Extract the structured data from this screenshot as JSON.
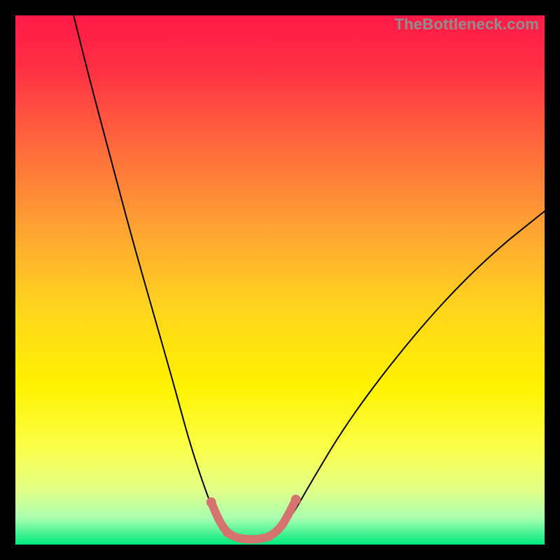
{
  "watermark": "TheBottleneck.com",
  "chart_data": {
    "type": "line",
    "title": "",
    "xlabel": "",
    "ylabel": "",
    "xlim": [
      0,
      100
    ],
    "ylim": [
      0,
      100
    ],
    "background_gradient": {
      "stops": [
        {
          "pos": 0.0,
          "color": "#ff1a47"
        },
        {
          "pos": 0.1,
          "color": "#ff2f44"
        },
        {
          "pos": 0.25,
          "color": "#ff6b3d"
        },
        {
          "pos": 0.4,
          "color": "#ffa233"
        },
        {
          "pos": 0.55,
          "color": "#ffd41e"
        },
        {
          "pos": 0.7,
          "color": "#fff200"
        },
        {
          "pos": 0.82,
          "color": "#faff4a"
        },
        {
          "pos": 0.9,
          "color": "#e0ff8a"
        },
        {
          "pos": 0.95,
          "color": "#a8ffb0"
        },
        {
          "pos": 1.0,
          "color": "#00e97e"
        }
      ]
    },
    "series": [
      {
        "name": "bottleneck-curve",
        "stroke": "#000000",
        "points": [
          {
            "x": 11,
            "y": 100
          },
          {
            "x": 14,
            "y": 88
          },
          {
            "x": 18,
            "y": 73
          },
          {
            "x": 22,
            "y": 58
          },
          {
            "x": 26,
            "y": 44
          },
          {
            "x": 30,
            "y": 30
          },
          {
            "x": 33,
            "y": 19
          },
          {
            "x": 36,
            "y": 10
          },
          {
            "x": 38,
            "y": 5
          },
          {
            "x": 40,
            "y": 1.5
          },
          {
            "x": 43,
            "y": 0.5
          },
          {
            "x": 46,
            "y": 0.5
          },
          {
            "x": 49,
            "y": 1.5
          },
          {
            "x": 52,
            "y": 5
          },
          {
            "x": 56,
            "y": 12
          },
          {
            "x": 62,
            "y": 22
          },
          {
            "x": 70,
            "y": 33
          },
          {
            "x": 80,
            "y": 45
          },
          {
            "x": 90,
            "y": 55
          },
          {
            "x": 100,
            "y": 63
          }
        ]
      },
      {
        "name": "optimal-zone-marker",
        "stroke": "#d5736f",
        "stroke_width": 12,
        "points": [
          {
            "x": 37,
            "y": 8
          },
          {
            "x": 38.5,
            "y": 4.5
          },
          {
            "x": 40,
            "y": 2.2
          },
          {
            "x": 42,
            "y": 1.2
          },
          {
            "x": 44,
            "y": 1.0
          },
          {
            "x": 46,
            "y": 1.0
          },
          {
            "x": 48,
            "y": 1.5
          },
          {
            "x": 50,
            "y": 3.0
          },
          {
            "x": 51.5,
            "y": 5.5
          },
          {
            "x": 53,
            "y": 8.5
          }
        ]
      }
    ]
  }
}
